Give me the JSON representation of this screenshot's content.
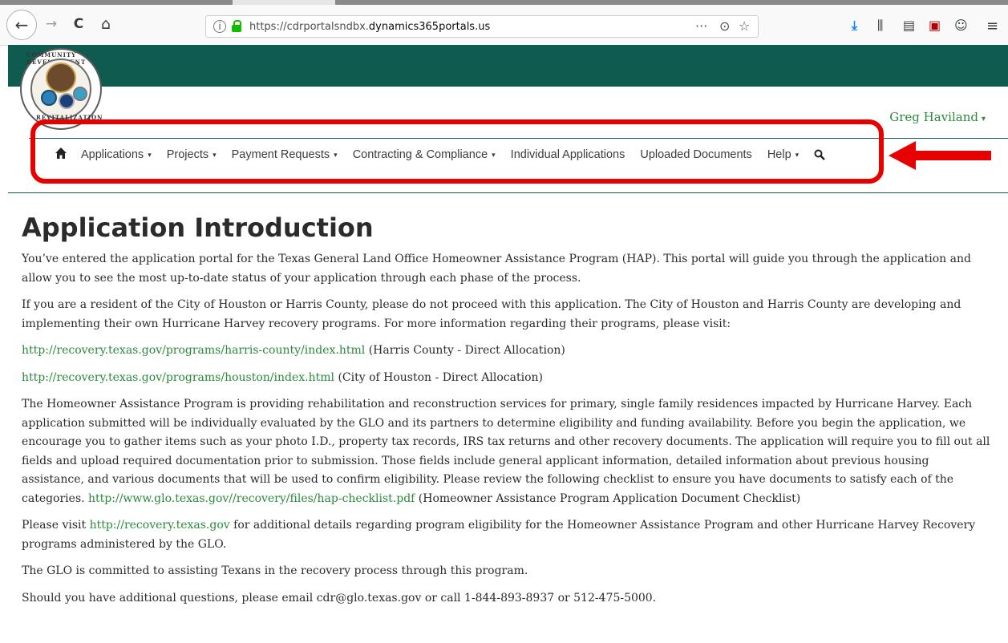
{
  "browser": {
    "url_prefix": "https://cdrportalsndbx.",
    "url_host": "dynamics365portals.us",
    "icons": [
      "back-icon",
      "forward-icon",
      "reload-icon",
      "home-icon",
      "info-icon",
      "lock-icon",
      "more-icon",
      "pocket-icon",
      "star-icon",
      "download-icon",
      "library-icon",
      "sidebar-icon",
      "pdf-icon",
      "account-icon",
      "menu-icon"
    ],
    "glyphs": {
      "back": "←",
      "forward": "→",
      "reload": "C",
      "home": "⌂",
      "more": "···",
      "pocket": "⊙",
      "star": "☆",
      "download": "⤓",
      "library": "⫼",
      "sidebar": "▤",
      "pdf": "▣",
      "account": "☺",
      "menu": "≡",
      "info": "i"
    }
  },
  "header": {
    "bar_color": "#0f5b50",
    "logo_top": "COMMUNITY DEVELOPMENT",
    "logo_bottom": "REVITALIZATION",
    "user_name": "Greg Haviland",
    "user_caret": "▾"
  },
  "nav": {
    "home_glyph": "⌂",
    "items": [
      {
        "label": "Applications",
        "dropdown": true
      },
      {
        "label": "Projects",
        "dropdown": true
      },
      {
        "label": "Payment Requests",
        "dropdown": true
      },
      {
        "label": "Contracting & Compliance",
        "dropdown": true
      },
      {
        "label": "Individual Applications",
        "dropdown": false
      },
      {
        "label": "Uploaded Documents",
        "dropdown": false
      },
      {
        "label": "Help",
        "dropdown": true
      }
    ],
    "caret": "▾",
    "search_glyph": "⌕",
    "highlight_color": "#e60000"
  },
  "main": {
    "title": "Application Introduction",
    "p1": "You’ve entered the application portal for the Texas General Land Office Homeowner Assistance Program (HAP). This portal will guide you through the application and allow you to see the most up-to-date status of your application through each phase of the process.",
    "p2": "If you are a resident of the City of Houston or Harris County, please do not proceed with this application. The City of Houston and Harris County are developing and implementing their own Hurricane Harvey recovery programs. For more information regarding their programs, please visit:",
    "link1": "http://recovery.texas.gov/programs/harris-county/index.html",
    "link1_note": " (Harris County - Direct Allocation)",
    "link2": "http://recovery.texas.gov/programs/houston/index.html",
    "link2_note": " (City of Houston - Direct Allocation)",
    "p3": "The Homeowner Assistance Program is providing rehabilitation and reconstruction services for primary, single family residences impacted by Hurricane Harvey. Each application submitted will be individually evaluated by the GLO and its partners to determine eligibility and funding availability. Before you begin the application, we encourage you to gather items such as your photo I.D., property tax records, IRS tax returns and other recovery documents. The application will require you to fill out all fields and upload required documentation prior to submission. Those fields include general applicant information, detailed information about previous housing assistance, and various documents that will be used to confirm eligibility. Please review the following checklist to ensure you have documents to satisfy each of the categories. ",
    "link3": "http://www.glo.texas.gov//recovery/files/hap-checklist.pdf",
    "link3_note": " (Homeowner Assistance Program Application Document Checklist)",
    "p4_pre": "Please visit ",
    "link4": "http://recovery.texas.gov",
    "p4_post": " for additional details regarding program eligibility for the Homeowner Assistance Program and other Hurricane Harvey Recovery programs administered by the GLO.",
    "p5": "The GLO is committed to assisting Texans in the recovery process through this program.",
    "p6": "Should you have additional questions, please email cdr@glo.texas.gov or call 1-844-893-8937 or 512-475-5000."
  }
}
